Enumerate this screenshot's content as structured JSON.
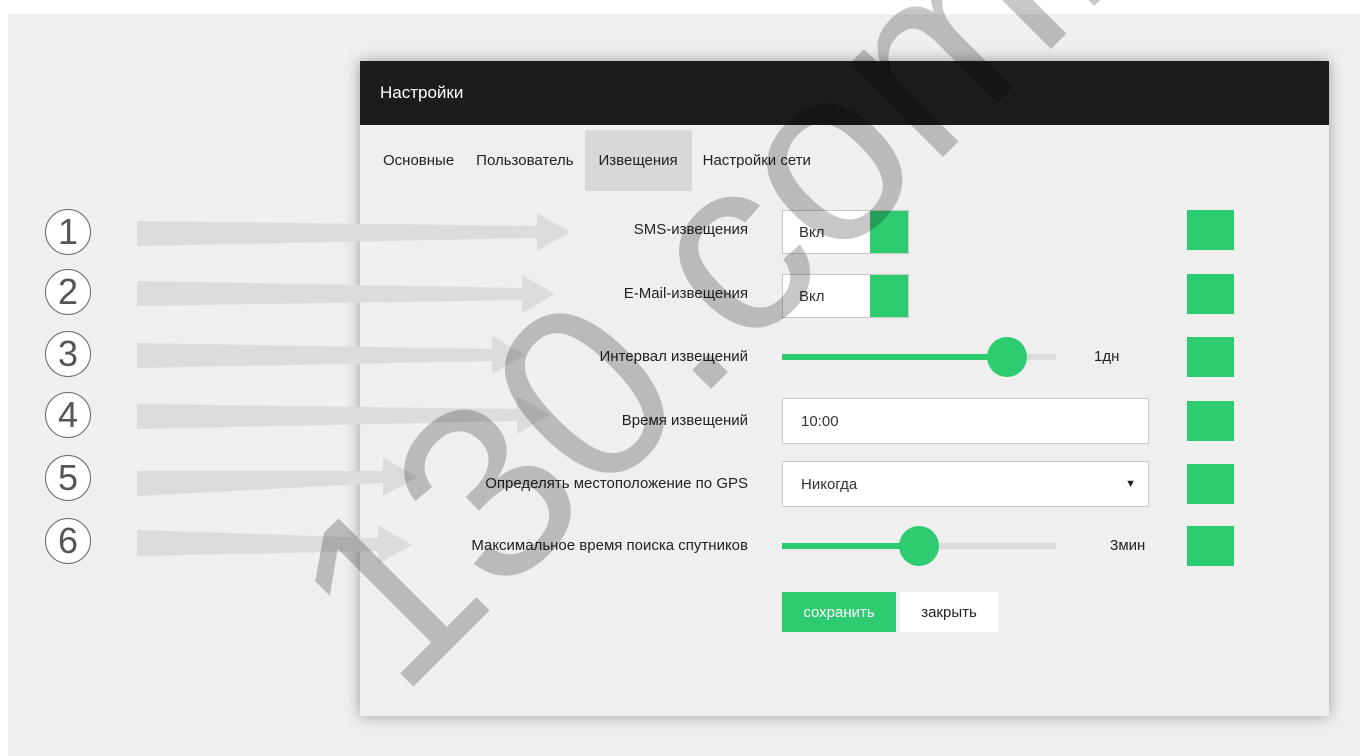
{
  "dialog": {
    "title": "Настройки",
    "tabs": [
      {
        "label": "Основные",
        "active": false
      },
      {
        "label": "Пользователь",
        "active": false
      },
      {
        "label": "Извещения",
        "active": true
      },
      {
        "label": "Настройки сети",
        "active": false
      }
    ],
    "fields": {
      "sms": {
        "label": "SMS-извещения",
        "value": "Вкл"
      },
      "email": {
        "label": "E-Mail-извещения",
        "value": "Вкл"
      },
      "interval": {
        "label": "Интервал извещений",
        "value": "1дн",
        "level_fraction": 0.82
      },
      "time": {
        "label": "Время извещений",
        "value": "10:00"
      },
      "gps": {
        "label": "Определять местоположение по GPS",
        "value": "Никогда"
      },
      "satellite": {
        "label": "Максимальное время поиска спутников",
        "value": "3мин",
        "level_fraction": 0.5
      }
    },
    "help_label": "?",
    "buttons": {
      "save": "сохранить",
      "close": "закрыть"
    }
  },
  "callouts": [
    "1",
    "2",
    "3",
    "4",
    "5",
    "6"
  ],
  "watermark": "130.com.ua",
  "colors": {
    "accent": "#2ecc71",
    "header": "#1c1c1c",
    "panel": "#efefef"
  }
}
